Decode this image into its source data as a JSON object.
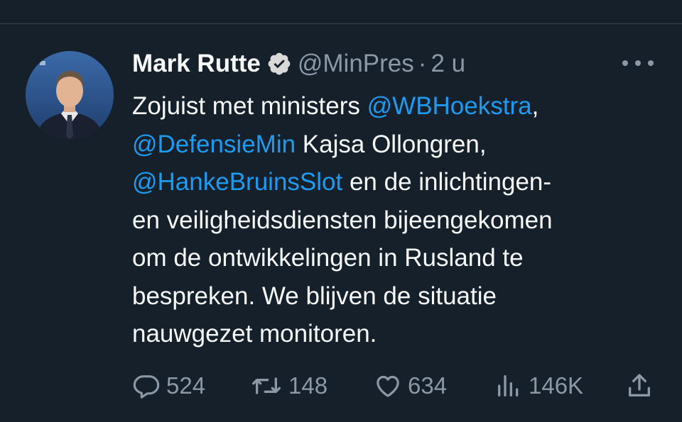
{
  "tweet": {
    "author": {
      "display_name": "Mark Rutte",
      "handle": "@MinPres",
      "verified": true,
      "avatar_icon": "profile-photo"
    },
    "separator": "·",
    "timestamp": "2 u",
    "text_lines": [
      [
        {
          "text": "Zojuist met ministers ",
          "mention": false
        },
        {
          "text": "@WBHoekstra",
          "mention": true
        },
        {
          "text": ",",
          "mention": false
        }
      ],
      [
        {
          "text": "@DefensieMin",
          "mention": true
        },
        {
          "text": " Kajsa Ollongren,",
          "mention": false
        }
      ],
      [
        {
          "text": "@HankeBruinsSlot",
          "mention": true
        },
        {
          "text": " en de inlichtingen-",
          "mention": false
        }
      ],
      [
        {
          "text": "en veiligheidsdiensten bijeengekomen",
          "mention": false
        }
      ],
      [
        {
          "text": "om de ontwikkelingen in Rusland te",
          "mention": false
        }
      ],
      [
        {
          "text": "bespreken. We blijven de situatie",
          "mention": false
        }
      ],
      [
        {
          "text": "nauwgezet monitoren.",
          "mention": false
        }
      ]
    ],
    "metrics": {
      "replies": "524",
      "retweets": "148",
      "likes": "634",
      "views": "146K"
    },
    "icons": {
      "reply": "reply-icon",
      "retweet": "retweet-icon",
      "like": "heart-icon",
      "views": "views-icon",
      "share": "share-icon",
      "more": "more-icon"
    }
  },
  "colors": {
    "background": "#15202b",
    "text": "#f7f9f9",
    "muted": "#8b98a5",
    "mention": "#1d9bf0",
    "verified_badge": "#d9d9d9"
  }
}
